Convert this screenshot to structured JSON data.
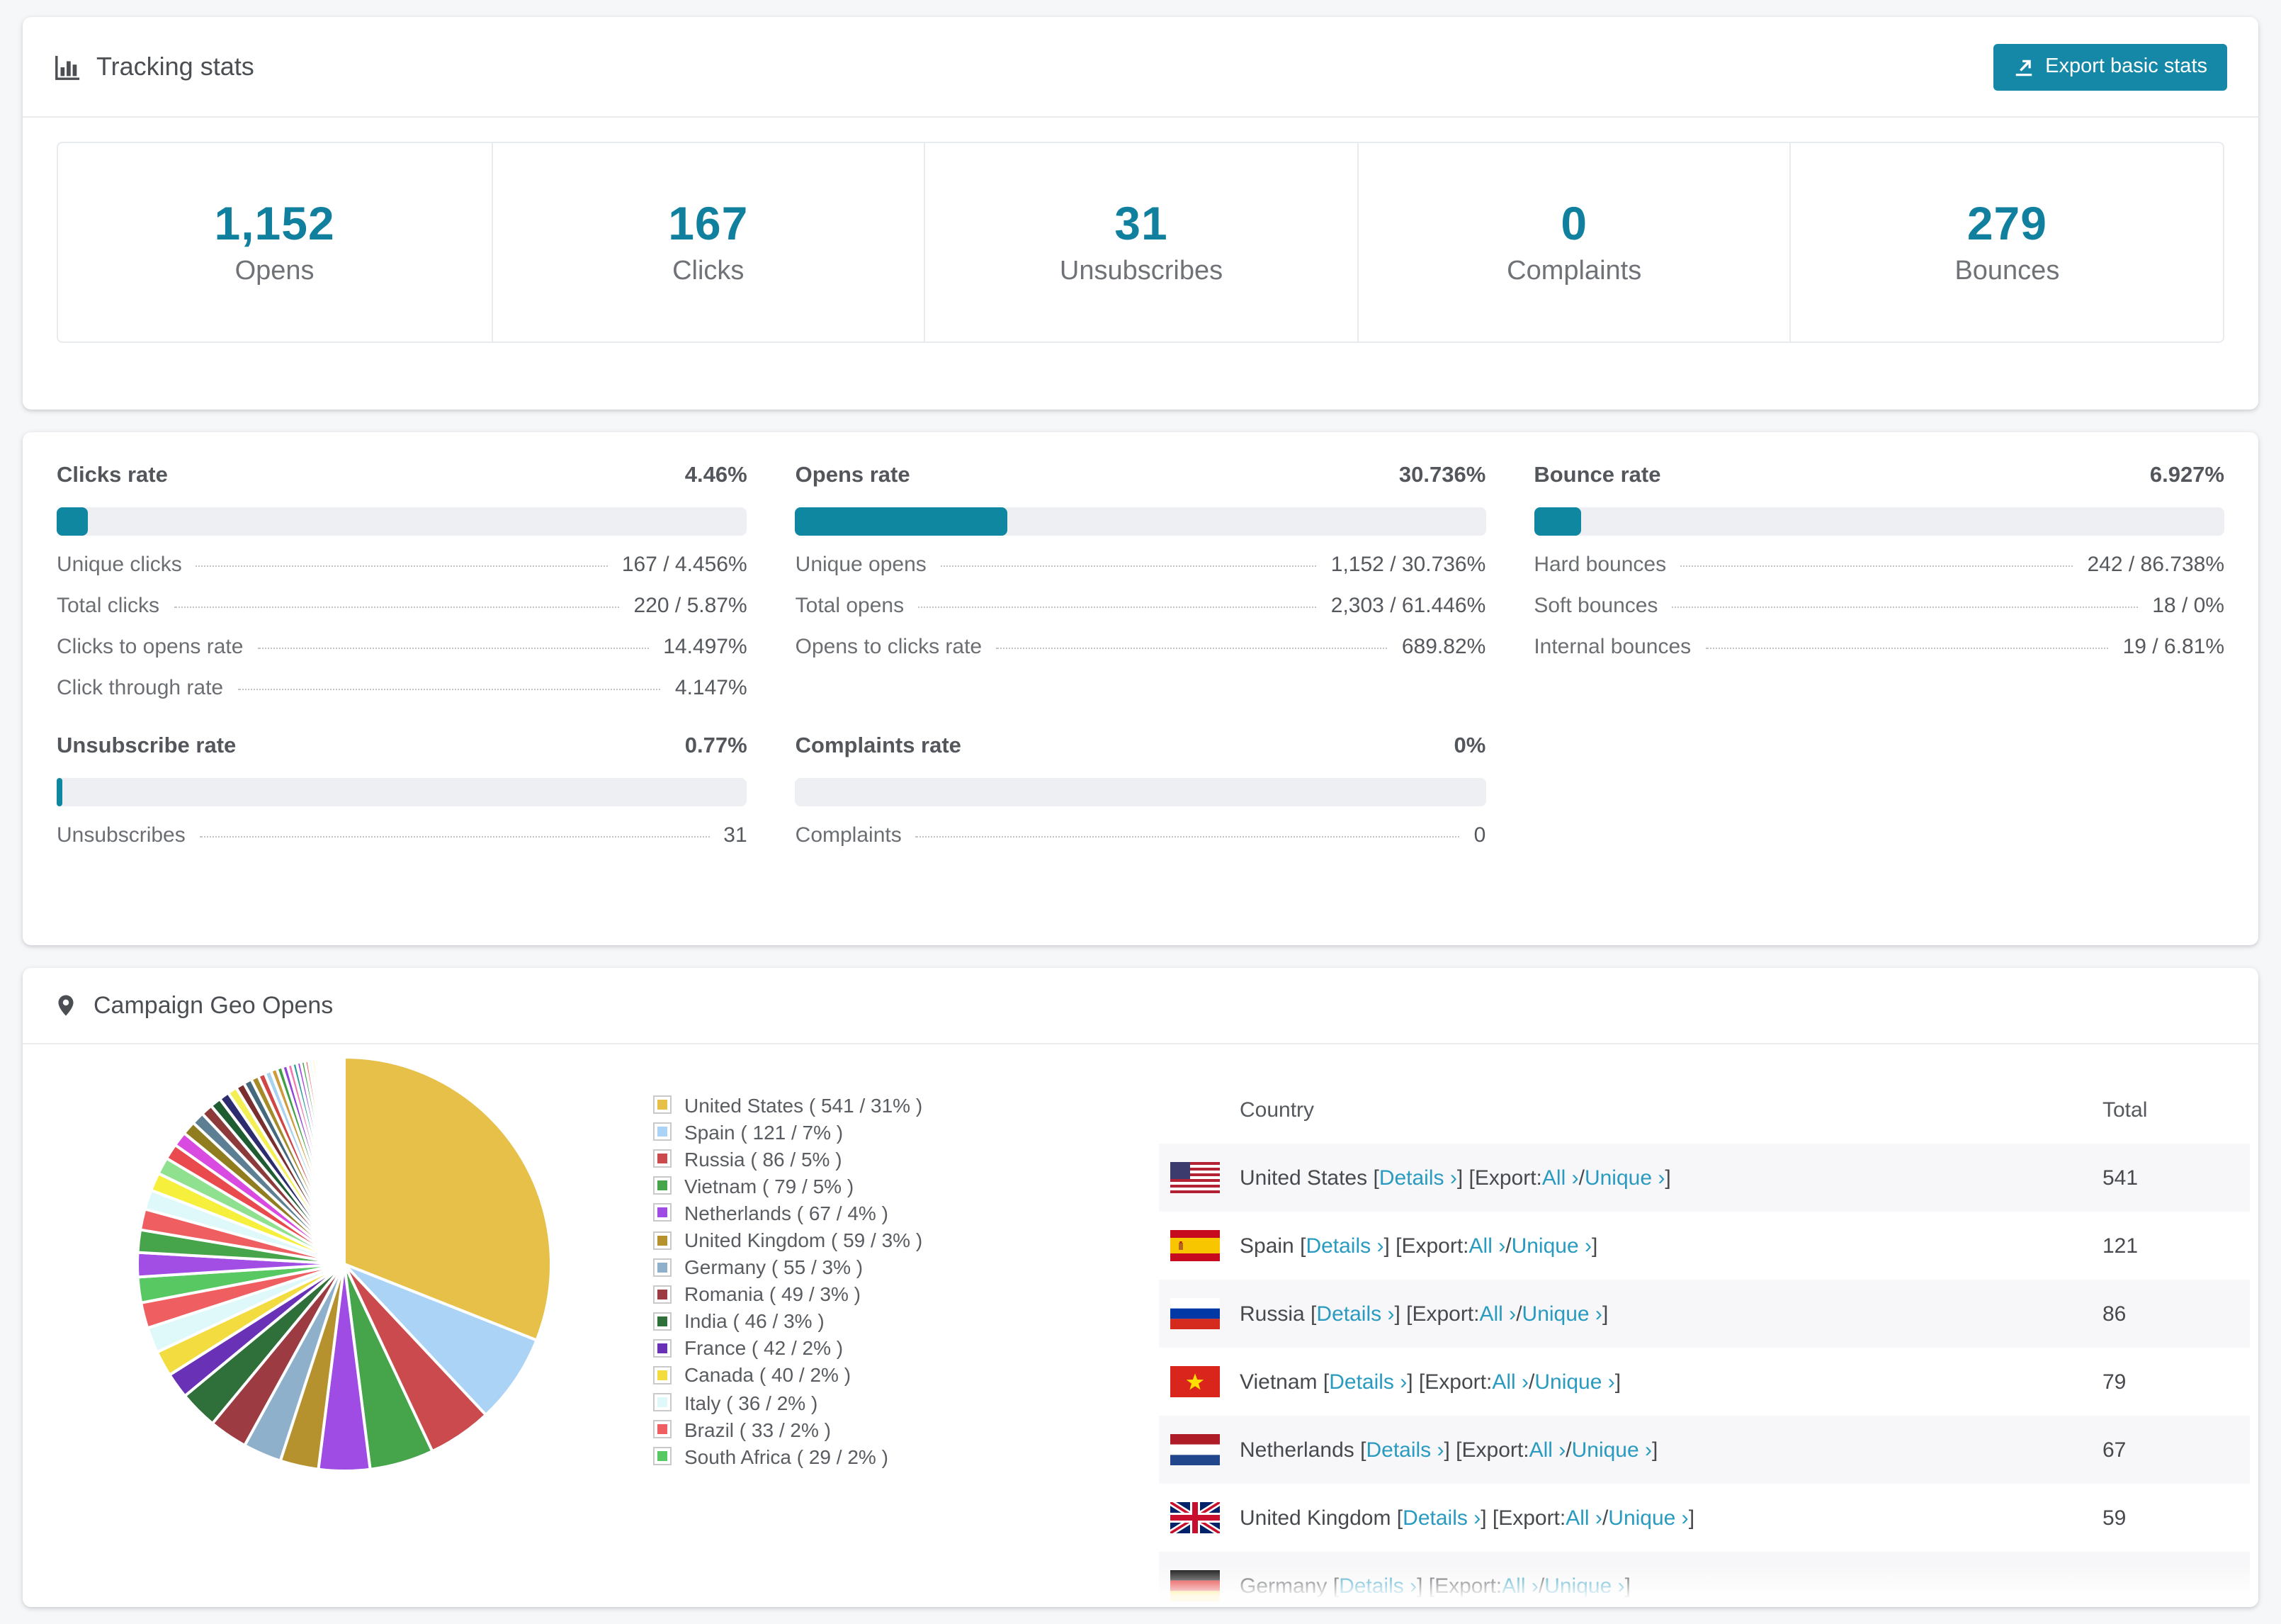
{
  "colors": {
    "accent_teal": "#0f87a0",
    "button_teal": "#1488a6",
    "link_teal": "#2a9bc0",
    "number_teal": "#10809e"
  },
  "tracking": {
    "title": "Tracking stats",
    "export_label": "Export basic stats",
    "summary": [
      {
        "value": "1,152",
        "label": "Opens"
      },
      {
        "value": "167",
        "label": "Clicks"
      },
      {
        "value": "31",
        "label": "Unsubscribes"
      },
      {
        "value": "0",
        "label": "Complaints"
      },
      {
        "value": "279",
        "label": "Bounces"
      }
    ]
  },
  "rates": [
    {
      "title": "Clicks rate",
      "value": "4.46%",
      "percent": 4.46,
      "rows": [
        {
          "label": "Unique clicks",
          "value": "167 / 4.456%"
        },
        {
          "label": "Total clicks",
          "value": "220 / 5.87%"
        },
        {
          "label": "Clicks to opens rate",
          "value": "14.497%"
        },
        {
          "label": "Click through rate",
          "value": "4.147%"
        }
      ]
    },
    {
      "title": "Opens rate",
      "value": "30.736%",
      "percent": 30.736,
      "rows": [
        {
          "label": "Unique opens",
          "value": "1,152 / 30.736%"
        },
        {
          "label": "Total opens",
          "value": "2,303 / 61.446%"
        },
        {
          "label": "Opens to clicks rate",
          "value": "689.82%"
        }
      ]
    },
    {
      "title": "Bounce rate",
      "value": "6.927%",
      "percent": 6.927,
      "rows": [
        {
          "label": "Hard bounces",
          "value": "242 / 86.738%"
        },
        {
          "label": "Soft bounces",
          "value": "18 / 0%"
        },
        {
          "label": "Internal bounces",
          "value": "19 / 6.81%"
        }
      ]
    },
    {
      "title": "Unsubscribe rate",
      "value": "0.77%",
      "percent": 0.77,
      "rows": [
        {
          "label": "Unsubscribes",
          "value": "31"
        }
      ]
    },
    {
      "title": "Complaints rate",
      "value": "0%",
      "percent": 0,
      "rows": [
        {
          "label": "Complaints",
          "value": "0"
        }
      ]
    }
  ],
  "geo": {
    "title": "Campaign Geo Opens",
    "table": {
      "headers": [
        "Country",
        "Total"
      ],
      "link_labels": {
        "open_bracket": "[",
        "close_bracket": "]",
        "details": "Details ›",
        "export_word": "Export:",
        "all": "All ›",
        "slash": "/",
        "unique": "Unique ›"
      },
      "rows": [
        {
          "name": "United States",
          "flag": "us",
          "total": "541",
          "partial": false
        },
        {
          "name": "Spain",
          "flag": "es",
          "total": "121",
          "partial": false
        },
        {
          "name": "Russia",
          "flag": "ru",
          "total": "86",
          "partial": false
        },
        {
          "name": "Vietnam",
          "flag": "vn",
          "total": "79",
          "partial": false
        },
        {
          "name": "Netherlands",
          "flag": "nl",
          "total": "67",
          "partial": false
        },
        {
          "name": "United Kingdom",
          "flag": "gb",
          "total": "59",
          "partial": false
        },
        {
          "name": "Germany",
          "flag": "de",
          "total": "",
          "partial": true
        }
      ]
    }
  },
  "chart_data": {
    "type": "pie",
    "title": "Campaign Geo Opens",
    "legend_position": "right",
    "start_angle_deg": -90,
    "direction": "clockwise",
    "countries": [
      {
        "label": "United States",
        "value": 541,
        "pct": 31,
        "color": "#e7c04a"
      },
      {
        "label": "Spain",
        "value": 121,
        "pct": 7,
        "color": "#abd3f5"
      },
      {
        "label": "Russia",
        "value": 86,
        "pct": 5,
        "color": "#ca4a4e"
      },
      {
        "label": "Vietnam",
        "value": 79,
        "pct": 5,
        "color": "#46a44a"
      },
      {
        "label": "Netherlands",
        "value": 67,
        "pct": 4,
        "color": "#9e4ce4"
      },
      {
        "label": "United Kingdom",
        "value": 59,
        "pct": 3,
        "color": "#b5922e"
      },
      {
        "label": "Germany",
        "value": 55,
        "pct": 3,
        "color": "#8fb0ca"
      },
      {
        "label": "Romania",
        "value": 49,
        "pct": 3,
        "color": "#9c3b41"
      },
      {
        "label": "India",
        "value": 46,
        "pct": 3,
        "color": "#2f6f39"
      },
      {
        "label": "France",
        "value": 42,
        "pct": 2,
        "color": "#6931b5"
      },
      {
        "label": "Canada",
        "value": 40,
        "pct": 2,
        "color": "#f2dc3f"
      },
      {
        "label": "Italy",
        "value": 36,
        "pct": 2,
        "color": "#dff9fb"
      },
      {
        "label": "Brazil",
        "value": 33,
        "pct": 2,
        "color": "#ef5f62"
      },
      {
        "label": "South Africa",
        "value": 29,
        "pct": 2,
        "color": "#58c863"
      }
    ],
    "others": {
      "count": 45,
      "decay": 0.93,
      "palette": [
        "#a24de4",
        "#46a44a",
        "#ef5f62",
        "#dff9fb",
        "#f6ef3c",
        "#8fe08f",
        "#e84a4e",
        "#d94ae0",
        "#8f7d20",
        "#5d7f93",
        "#8d3a3a",
        "#1e5c31",
        "#2c2c6e",
        "#f3ef55",
        "#7a2e2e",
        "#44687d",
        "#a58a2a",
        "#d14545",
        "#a8d2f0",
        "#cf9a3a",
        "#3f9f43",
        "#8f46d9",
        "#f07ab0",
        "#2aa198"
      ]
    },
    "legend_format": "{label} ( {value} / {pct}% )"
  }
}
